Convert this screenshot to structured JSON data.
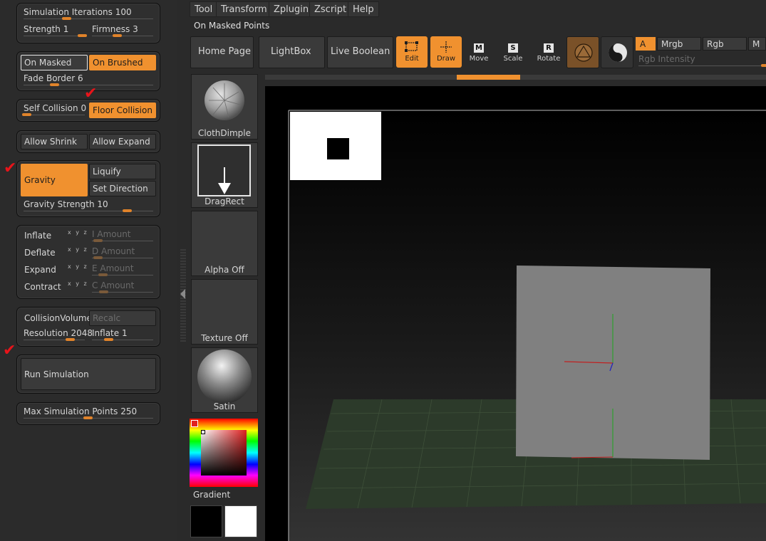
{
  "left_panel": {
    "sim_iterations": "Simulation Iterations",
    "sim_iterations_value": "100",
    "strength": "Strength",
    "strength_value": "1",
    "firmness": "Firmness",
    "firmness_value": "3",
    "on_masked": "On Masked",
    "on_brushed": "On Brushed",
    "fade_border": "Fade Border",
    "fade_border_value": "6",
    "self_collision": "Self Collision",
    "self_collision_value": "0",
    "floor_collision": "Floor Collision",
    "allow_shrink": "Allow Shrink",
    "allow_expand": "Allow Expand",
    "gravity": "Gravity",
    "liquify": "Liquify",
    "set_direction": "Set Direction",
    "gravity_strength": "Gravity Strength",
    "gravity_strength_value": "10",
    "inflate": "Inflate",
    "deflate": "Deflate",
    "expand": "Expand",
    "contract": "Contract",
    "xyz": "x y z",
    "i_amount": "I Amount",
    "d_amount": "D Amount",
    "e_amount": "E Amount",
    "c_amount": "C Amount",
    "collision_volume": "CollisionVolume",
    "recalc": "Recalc",
    "resolution": "Resolution",
    "resolution_value": "2048",
    "inflate_cv": "Inflate",
    "inflate_cv_value": "1",
    "run_simulation": "Run Simulation",
    "max_sim_points": "Max Simulation Points",
    "max_sim_points_value": "250"
  },
  "menubar": {
    "tool": "Tool",
    "transform": "Transform",
    "zplugin": "Zplugin",
    "zscript": "Zscript",
    "help": "Help"
  },
  "status_text": "On Masked Points",
  "toolbar": {
    "home_page": "Home Page",
    "lightbox": "LightBox",
    "live_boolean": "Live Boolean",
    "edit": "Edit",
    "draw": "Draw",
    "move": "Move",
    "scale": "Scale",
    "rotate": "Rotate",
    "move_key": "M",
    "scale_key": "S",
    "rotate_key": "R",
    "a": "A",
    "mrgb": "Mrgb",
    "rgb": "Rgb",
    "m": "M",
    "rgb_intensity": "Rgb Intensity"
  },
  "thumbnails": {
    "cloth_dimple": "ClothDimple",
    "drag_rect": "DragRect",
    "alpha_off": "Alpha Off",
    "texture_off": "Texture Off",
    "satin": "Satin",
    "gradient": "Gradient"
  },
  "colors": {
    "accent_orange": "#f0912f",
    "check_red": "#e8141a",
    "floor_green": "#2c3a2a"
  }
}
